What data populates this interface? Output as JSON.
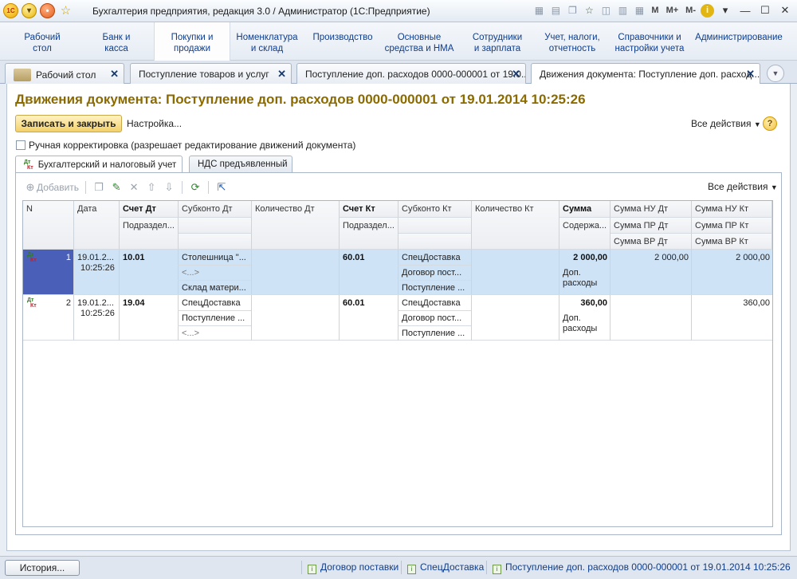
{
  "window": {
    "title": "Бухгалтерия предприятия, редакция 3.0 / Администратор  (1С:Предприятие)",
    "logo_text": "1С",
    "memo_buttons": [
      "M",
      "M+",
      "M-"
    ]
  },
  "sections": [
    {
      "label": "Рабочий стол",
      "lines": [
        "Рабочий",
        "стол"
      ]
    },
    {
      "label": "Банк и касса",
      "lines": [
        "Банк и",
        "касса"
      ]
    },
    {
      "label": "Покупки и продажи",
      "lines": [
        "Покупки и",
        "продажи"
      ],
      "active": true
    },
    {
      "label": "Номенклатура и склад",
      "lines": [
        "Номенклатура",
        "и склад"
      ]
    },
    {
      "label": "Производство",
      "lines": [
        "Производство",
        ""
      ]
    },
    {
      "label": "Основные средства и НМА",
      "lines": [
        "Основные",
        "средства и НМА"
      ]
    },
    {
      "label": "Сотрудники и зарплата",
      "lines": [
        "Сотрудники",
        "и зарплата"
      ]
    },
    {
      "label": "Учет, налоги, отчетность",
      "lines": [
        "Учет, налоги,",
        "отчетность"
      ]
    },
    {
      "label": "Справочники и настройки учета",
      "lines": [
        "Справочники и",
        "настройки учета"
      ]
    },
    {
      "label": "Администрирование",
      "lines": [
        "Администрирование",
        ""
      ]
    }
  ],
  "window_tabs": [
    {
      "label": "Рабочий стол"
    },
    {
      "label": "Поступление товаров и услуг"
    },
    {
      "label": "Поступление доп. расходов 0000-000001 от 19.0..."
    },
    {
      "label": "Движения документа: Поступление доп. расход...",
      "active": true
    }
  ],
  "document": {
    "title": "Движения документа: Поступление доп. расходов 0000-000001 от 19.01.2014 10:25:26",
    "save_close_label": "Записать и закрыть",
    "settings_label": "Настройка...",
    "all_actions_label": "Все действия",
    "help_label": "?",
    "manual_checkbox_label": "Ручная корректировка (разрешает редактирование движений документа)",
    "inner_tabs": [
      "Бухгалтерский и налоговый учет",
      "НДС предъявленный"
    ],
    "dtkt": {
      "dt": "Дт",
      "kt": "Кт"
    }
  },
  "toolbar": {
    "add_label": "Добавить",
    "all_actions_label": "Все действия"
  },
  "grid": {
    "headers": {
      "n": "N",
      "date": "Дата",
      "acc_dt": "Счет Дт",
      "sub_dt": "Субконто Дт",
      "qty_dt": "Количество Дт",
      "acc_kt": "Счет Кт",
      "sub_kt": "Субконто Кт",
      "qty_kt": "Количество Кт",
      "sum": "Сумма",
      "nu_dt": "Сумма НУ Дт",
      "nu_kt": "Сумма НУ Кт",
      "div_dt": "Подраздел...",
      "div_kt": "Подраздел...",
      "content": "Содержа...",
      "pr_dt": "Сумма ПР Дт",
      "pr_kt": "Сумма ПР Кт",
      "vr_dt": "Сумма ВР Дт",
      "vr_kt": "Сумма ВР Кт"
    },
    "rows": [
      {
        "n": "1",
        "date": "19.01.2...",
        "time": "10:25:26",
        "acc_dt": "10.01",
        "sub_dt": [
          "Столешница \"...",
          "<...>",
          "Склад матери..."
        ],
        "acc_kt": "60.01",
        "sub_kt": [
          "СпецДоставка",
          "Договор пост...",
          "Поступление ..."
        ],
        "sum": "2 000,00",
        "content": [
          "Доп.",
          "расходы"
        ],
        "nu_dt": "2 000,00",
        "nu_kt": "2 000,00"
      },
      {
        "n": "2",
        "date": "19.01.2...",
        "time": "10:25:26",
        "acc_dt": "19.04",
        "sub_dt": [
          "СпецДоставка",
          "Поступление ...",
          "<...>"
        ],
        "acc_kt": "60.01",
        "sub_kt": [
          "СпецДоставка",
          "Договор пост...",
          "Поступление ..."
        ],
        "sum": "360,00",
        "content": [
          "Доп.",
          "расходы"
        ],
        "nu_dt": "",
        "nu_kt": "360,00"
      }
    ]
  },
  "statusbar": {
    "history_label": "История...",
    "items": [
      "Договор поставки",
      "СпецДоставка",
      "Поступление доп. расходов 0000-000001 от 19.01.2014 10:25:26"
    ]
  },
  "colors": {
    "title_color": "#8b6a00",
    "section_link": "#0f3d8c",
    "selected_row": "#cfe3f7",
    "selected_marker": "#4a5fb8"
  }
}
